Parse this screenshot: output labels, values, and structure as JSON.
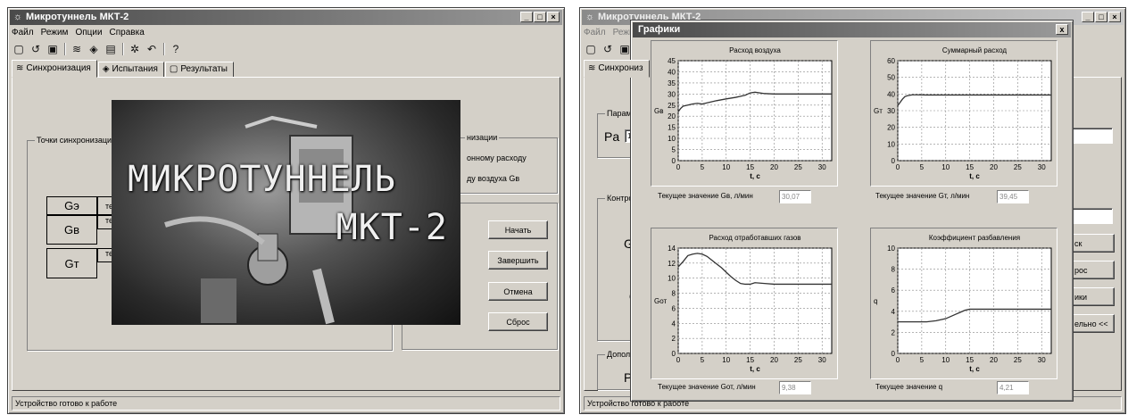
{
  "window1": {
    "title": "Микротуннель МКТ-2",
    "menu": [
      "Файл",
      "Режим",
      "Опции",
      "Справка"
    ],
    "tabs": [
      "Синхронизация",
      "Испытания",
      "Результаты"
    ],
    "sync_group_label": "Точки синхронизации",
    "right_group_label": "низации",
    "right_items": [
      "онному расходу",
      "ду воздуха Gв"
    ],
    "row_labels": [
      "Gэ",
      "Gв",
      "Gт"
    ],
    "row_values": [
      "те",
      "те",
      "те"
    ],
    "buttons": [
      "Начать",
      "Завершить",
      "Отмена",
      "Сброс"
    ],
    "splash_line1": "МИКРОТУННЕЛЬ",
    "splash_line2": "МКТ-2",
    "status": "Устройство готово к работе"
  },
  "window2": {
    "title": "Микротуннель МКТ-2",
    "menu": [
      "Файл",
      "Режим"
    ],
    "tab_label": "Синхрониз",
    "params_label": "Параметры",
    "pa_label": "Pа",
    "pa_value": "101",
    "control_label": "Контроль па",
    "gb_label": "Gв",
    "q_label": "q",
    "extra_label": "Дополнител",
    "pf_label": "Pf",
    "right_buttons": [
      "ск",
      "рос",
      "ики",
      "ельно <<"
    ],
    "status": "Устройство готово к работе"
  },
  "dialog": {
    "title": "Графики",
    "close": "x"
  },
  "chart_data": [
    {
      "type": "line",
      "title": "Расход воздуха",
      "xlabel": "t, с",
      "ylabel": "Gв",
      "xlim": [
        0,
        32
      ],
      "ylim": [
        0,
        45
      ],
      "xticks": [
        0,
        5,
        10,
        15,
        20,
        25,
        30
      ],
      "yticks": [
        0,
        5,
        10,
        15,
        20,
        25,
        30,
        35,
        40,
        45
      ],
      "grid": true,
      "x": [
        0,
        0.5,
        1,
        2,
        3,
        4,
        5,
        6,
        8,
        10,
        12,
        13,
        14,
        15,
        16,
        18,
        20,
        25,
        32
      ],
      "y": [
        22,
        23.5,
        24.5,
        25,
        25.5,
        25.8,
        25.5,
        26,
        27,
        27.8,
        28.5,
        29,
        29.5,
        30.5,
        30.8,
        30.2,
        30,
        30,
        30
      ],
      "readout_label": "Текущее значение Gв, л/мин",
      "readout_value": "30,07"
    },
    {
      "type": "line",
      "title": "Суммарный расход",
      "xlabel": "t, с",
      "ylabel": "Gт",
      "xlim": [
        0,
        32
      ],
      "ylim": [
        0,
        60
      ],
      "xticks": [
        0,
        5,
        10,
        15,
        20,
        25,
        30
      ],
      "yticks": [
        0,
        10,
        20,
        30,
        40,
        50,
        60
      ],
      "grid": true,
      "x": [
        0,
        0.5,
        1,
        1.5,
        2,
        3,
        4,
        6,
        10,
        15,
        20,
        25,
        32
      ],
      "y": [
        33,
        35,
        37,
        38.5,
        39,
        39.5,
        39.5,
        39.4,
        39.4,
        39.4,
        39.4,
        39.4,
        39.4
      ],
      "readout_label": "Текущее значение Gт, л/мин",
      "readout_value": "39,45"
    },
    {
      "type": "line",
      "title": "Расход отработавших газов",
      "xlabel": "t, с",
      "ylabel": "Gот",
      "xlim": [
        0,
        32
      ],
      "ylim": [
        0,
        14
      ],
      "xticks": [
        0,
        5,
        10,
        15,
        20,
        25,
        30
      ],
      "yticks": [
        0,
        2,
        4,
        6,
        8,
        10,
        12,
        14
      ],
      "grid": true,
      "x": [
        0,
        1,
        2,
        3,
        4,
        5,
        6,
        7,
        8,
        9,
        10,
        11,
        12,
        13,
        14,
        15,
        16,
        18,
        20,
        25,
        32
      ],
      "y": [
        11.5,
        12.2,
        13,
        13.2,
        13.3,
        13.2,
        12.9,
        12.4,
        11.9,
        11.4,
        10.8,
        10.2,
        9.7,
        9.3,
        9.2,
        9.2,
        9.4,
        9.3,
        9.2,
        9.2,
        9.2
      ],
      "readout_label": "Текущее значение Gот, л/мин",
      "readout_value": "9,38"
    },
    {
      "type": "line",
      "title": "Коэффициент разбавления",
      "xlabel": "t, с",
      "ylabel": "q",
      "xlim": [
        0,
        32
      ],
      "ylim": [
        0,
        10
      ],
      "xticks": [
        0,
        5,
        10,
        15,
        20,
        25,
        30
      ],
      "yticks": [
        0,
        2,
        4,
        6,
        8,
        10
      ],
      "grid": true,
      "x": [
        0,
        2,
        4,
        6,
        8,
        10,
        11,
        12,
        13,
        14,
        15,
        16,
        18,
        20,
        25,
        32
      ],
      "y": [
        3,
        3,
        3,
        3,
        3.1,
        3.3,
        3.5,
        3.7,
        3.9,
        4.1,
        4.2,
        4.2,
        4.2,
        4.2,
        4.2,
        4.2
      ],
      "readout_label": "Текущее значение q",
      "readout_value": "4,21"
    }
  ]
}
